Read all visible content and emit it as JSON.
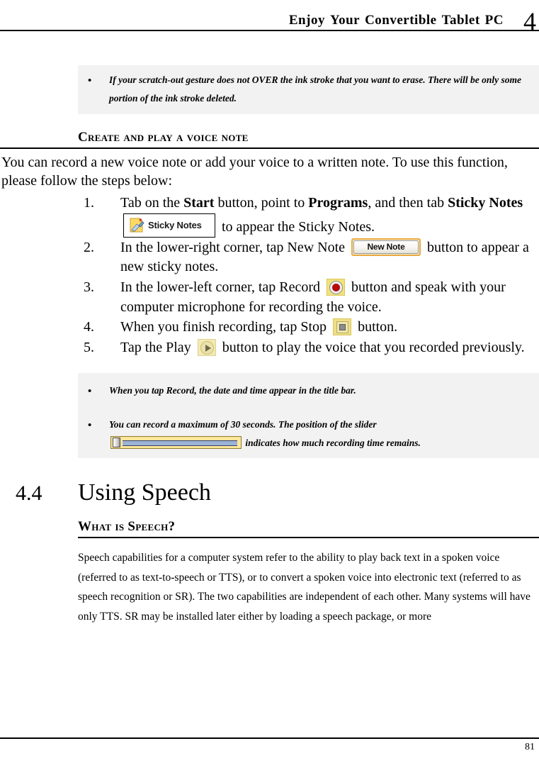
{
  "header": {
    "title_words": [
      "Enjoy",
      "Your",
      "Convertible",
      "Tablet",
      "PC"
    ],
    "chapter_number": "4"
  },
  "note_box_top": {
    "bullet_glyph": "•",
    "items": [
      "If your scratch-out gesture does not OVER the ink stroke that you want to erase. There will be only some portion of the ink stroke deleted."
    ]
  },
  "section_voice_note": {
    "heading": "Create and play a voice note",
    "intro": "You can record a new voice note or add your voice to a written note. To use this function, please follow the steps below:",
    "steps": [
      {
        "number": "1.",
        "part1": "Tab on the ",
        "bold1": "Start",
        "part2": " button, point to ",
        "bold2": "Programs",
        "part3": ", and then tab ",
        "bold3": "Sticky Notes",
        "widget": "sticky-notes-chip",
        "widget_label": "Sticky Notes",
        "part4": " to appear the Sticky Notes."
      },
      {
        "number": "2.",
        "part1": "In the lower-right corner, tap New Note ",
        "widget": "new-note-button",
        "widget_label": "New Note",
        "part2": " button to appear    a new sticky notes."
      },
      {
        "number": "3.",
        "part1": "In the lower-left corner, tap Record ",
        "widget": "record-button",
        "part2": " button and speak with your computer microphone for recording the voice."
      },
      {
        "number": "4.",
        "part1": "When you finish recording, tap Stop ",
        "widget": "stop-button",
        "part2": " button."
      },
      {
        "number": "5.",
        "part1": "Tap the Play ",
        "widget": "play-button",
        "part2": " button to play the voice that you recorded previously."
      }
    ]
  },
  "note_box_bottom": {
    "bullet_glyph": "•",
    "item1": "When you tap Record, the date and time appear in the title bar.",
    "item2_part1": "You can record a maximum of 30 seconds. The position of the slider",
    "item2_widget": "recording-time-slider",
    "item2_part2": " indicates how much recording time remains."
  },
  "section_speech": {
    "number": "4.4",
    "title": "Using Speech",
    "sub_heading": "What is Speech?",
    "paragraph": "Speech capabilities for a computer system refer to the ability to play back text in a spoken voice (referred to as text-to-speech or TTS), or to convert a spoken voice into electronic text (referred to as speech recognition or SR). The two capabilities are independent of each other. Many systems will have only TTS. SR may be installed later either by loading a speech package, or more"
  },
  "footer": {
    "page_number": "81"
  },
  "colors": {
    "note_box_bg": "#f2f2f2",
    "record_dot": "#b50b0b",
    "sticky_note_yellow": "#ffd966",
    "new_note_border": "#e8a93c",
    "slider_bg": "#ffe699",
    "slider_track": "#9db3d6"
  }
}
